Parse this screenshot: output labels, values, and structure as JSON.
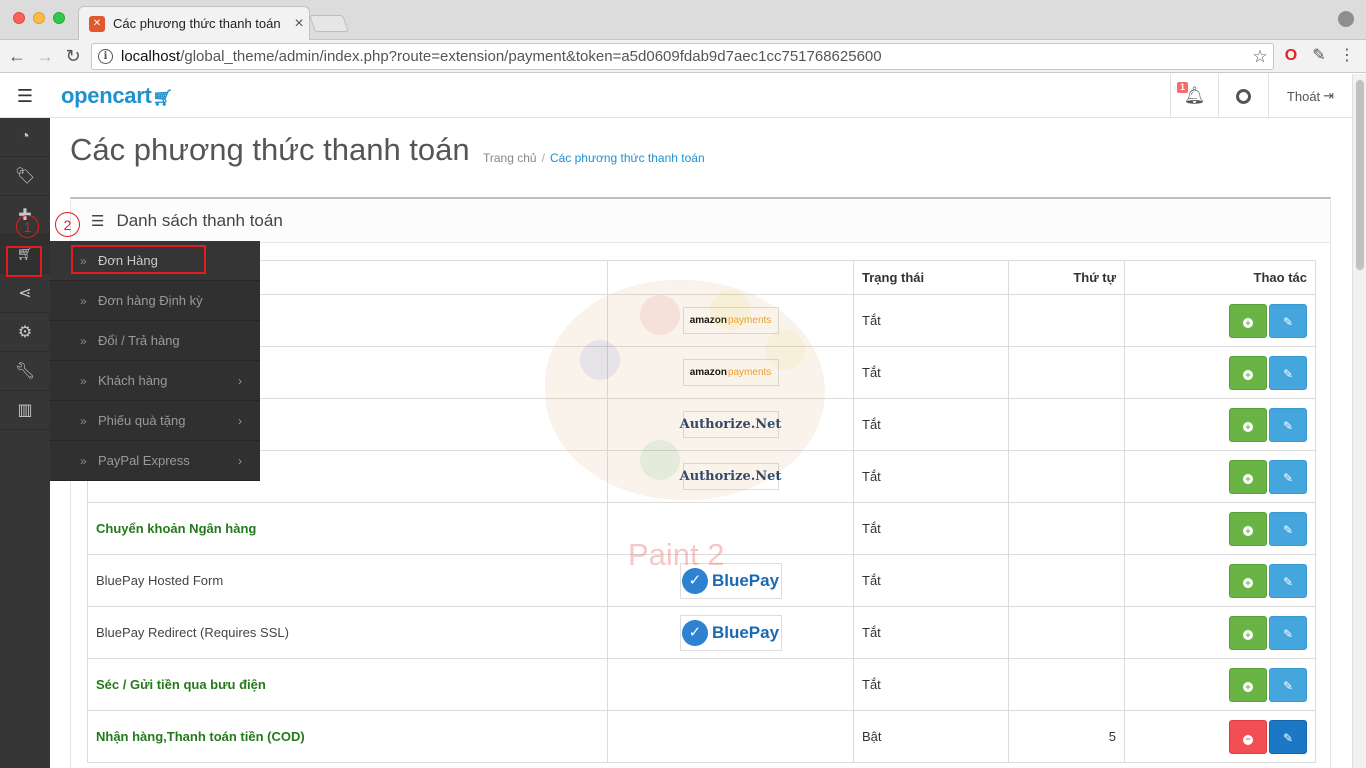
{
  "browser": {
    "tab_title": "Các phương thức thanh toán",
    "tab_close": "×",
    "url_host": "localhost",
    "url_rest": "/global_theme/admin/index.php?route=extension/payment&token=a5d0609fdab9d7aec1cc751768625600"
  },
  "header": {
    "logo": "opencart",
    "notification_count": "1",
    "logout": "Thoát"
  },
  "flyout": {
    "items": [
      {
        "label": "Đơn Hàng"
      },
      {
        "label": "Đơn hàng Định kỳ"
      },
      {
        "label": "Đổi / Trả hàng"
      },
      {
        "label": "Khách hàng"
      },
      {
        "label": "Phiếu quà tặng"
      },
      {
        "label": "PayPal Express"
      }
    ]
  },
  "annotations": {
    "first": "1",
    "second": "2"
  },
  "page": {
    "title": "Các phương thức thanh toán",
    "breadcrumb_home": "Trang chủ",
    "breadcrumb_sep": "/",
    "breadcrumb_current": "Các phương thức thanh toán",
    "panel_title": "Danh sách thanh toán",
    "watermark": "Paint 2"
  },
  "table": {
    "headers": {
      "status": "Trạng thái",
      "order": "Thứ tự",
      "action": "Thao tác"
    },
    "rows": [
      {
        "name": "",
        "logo": "amazon",
        "logo_text": "amazon",
        "logo_text2": "payments",
        "status": "Tắt",
        "order": "",
        "installed": false
      },
      {
        "name": "",
        "logo": "amazon",
        "logo_text": "amazon",
        "logo_text2": "payments",
        "status": "Tắt",
        "order": "",
        "installed": false
      },
      {
        "name": "",
        "logo": "authnet",
        "logo_text": "Authorize.Net",
        "logo_text2": "",
        "status": "Tắt",
        "order": "",
        "installed": false
      },
      {
        "name": "",
        "logo": "authnet",
        "logo_text": "Authorize.Net",
        "logo_text2": "",
        "status": "Tắt",
        "order": "",
        "installed": false
      },
      {
        "name": "Chuyển khoản Ngân hàng",
        "logo": "",
        "status": "Tắt",
        "order": "",
        "installed": false,
        "link": true
      },
      {
        "name": "BluePay Hosted Form",
        "logo": "bluepay",
        "logo_text": "BluePay",
        "logo_text2": "",
        "status": "Tắt",
        "order": "",
        "installed": false
      },
      {
        "name": "BluePay Redirect (Requires SSL)",
        "logo": "bluepay",
        "logo_text": "BluePay",
        "logo_text2": "",
        "status": "Tắt",
        "order": "",
        "installed": false
      },
      {
        "name": "Séc / Gửi tiền qua bưu điện",
        "logo": "",
        "status": "Tắt",
        "order": "",
        "installed": false,
        "link": true
      },
      {
        "name": "Nhận hàng,Thanh toán tiền (COD)",
        "logo": "",
        "status": "Bật",
        "order": "5",
        "installed": true,
        "link": true
      }
    ]
  },
  "colors": {
    "accent": "#1e91cf",
    "install": "#69b445",
    "edit": "#45a6de",
    "uninstall": "#f24f54",
    "link_green": "#237a1b",
    "annotation": "#e21b1b"
  }
}
